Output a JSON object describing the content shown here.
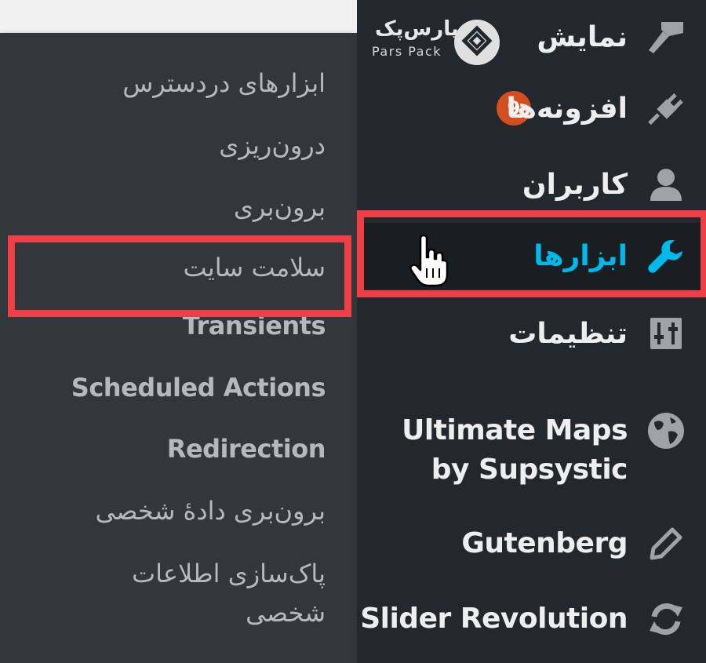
{
  "brand": {
    "name_fa": "پارس‌پک",
    "name_en": "Pars Pack"
  },
  "main_menu": {
    "appearance": "نمایش",
    "plugins": "افزونه‌ها",
    "plugins_badge": "9",
    "users": "کاربران",
    "tools": "ابزارها",
    "settings": "تنظیمات",
    "ultimate_maps": "Ultimate Maps by Supsystic",
    "gutenberg": "Gutenberg",
    "slider_revolution": "Slider Revolution"
  },
  "submenu": {
    "available_tools": "ابزارهای دردسترس",
    "import": "درون‌ریزی",
    "export": "برون‌بری",
    "site_health": "سلامت سایت",
    "transients": "Transients",
    "scheduled_actions": "Scheduled Actions",
    "redirection": "Redirection",
    "export_personal_data": "برون‌بری دادهٔ شخصی",
    "erase_personal_data": "پاک‌سازی اطلاعات شخصی"
  },
  "colors": {
    "menu_bg": "#23282d",
    "submenu_bg": "#32373c",
    "active_bg": "#191e23",
    "active_text": "#00b9eb",
    "highlight": "#ef3e46",
    "badge": "#d54e21"
  }
}
